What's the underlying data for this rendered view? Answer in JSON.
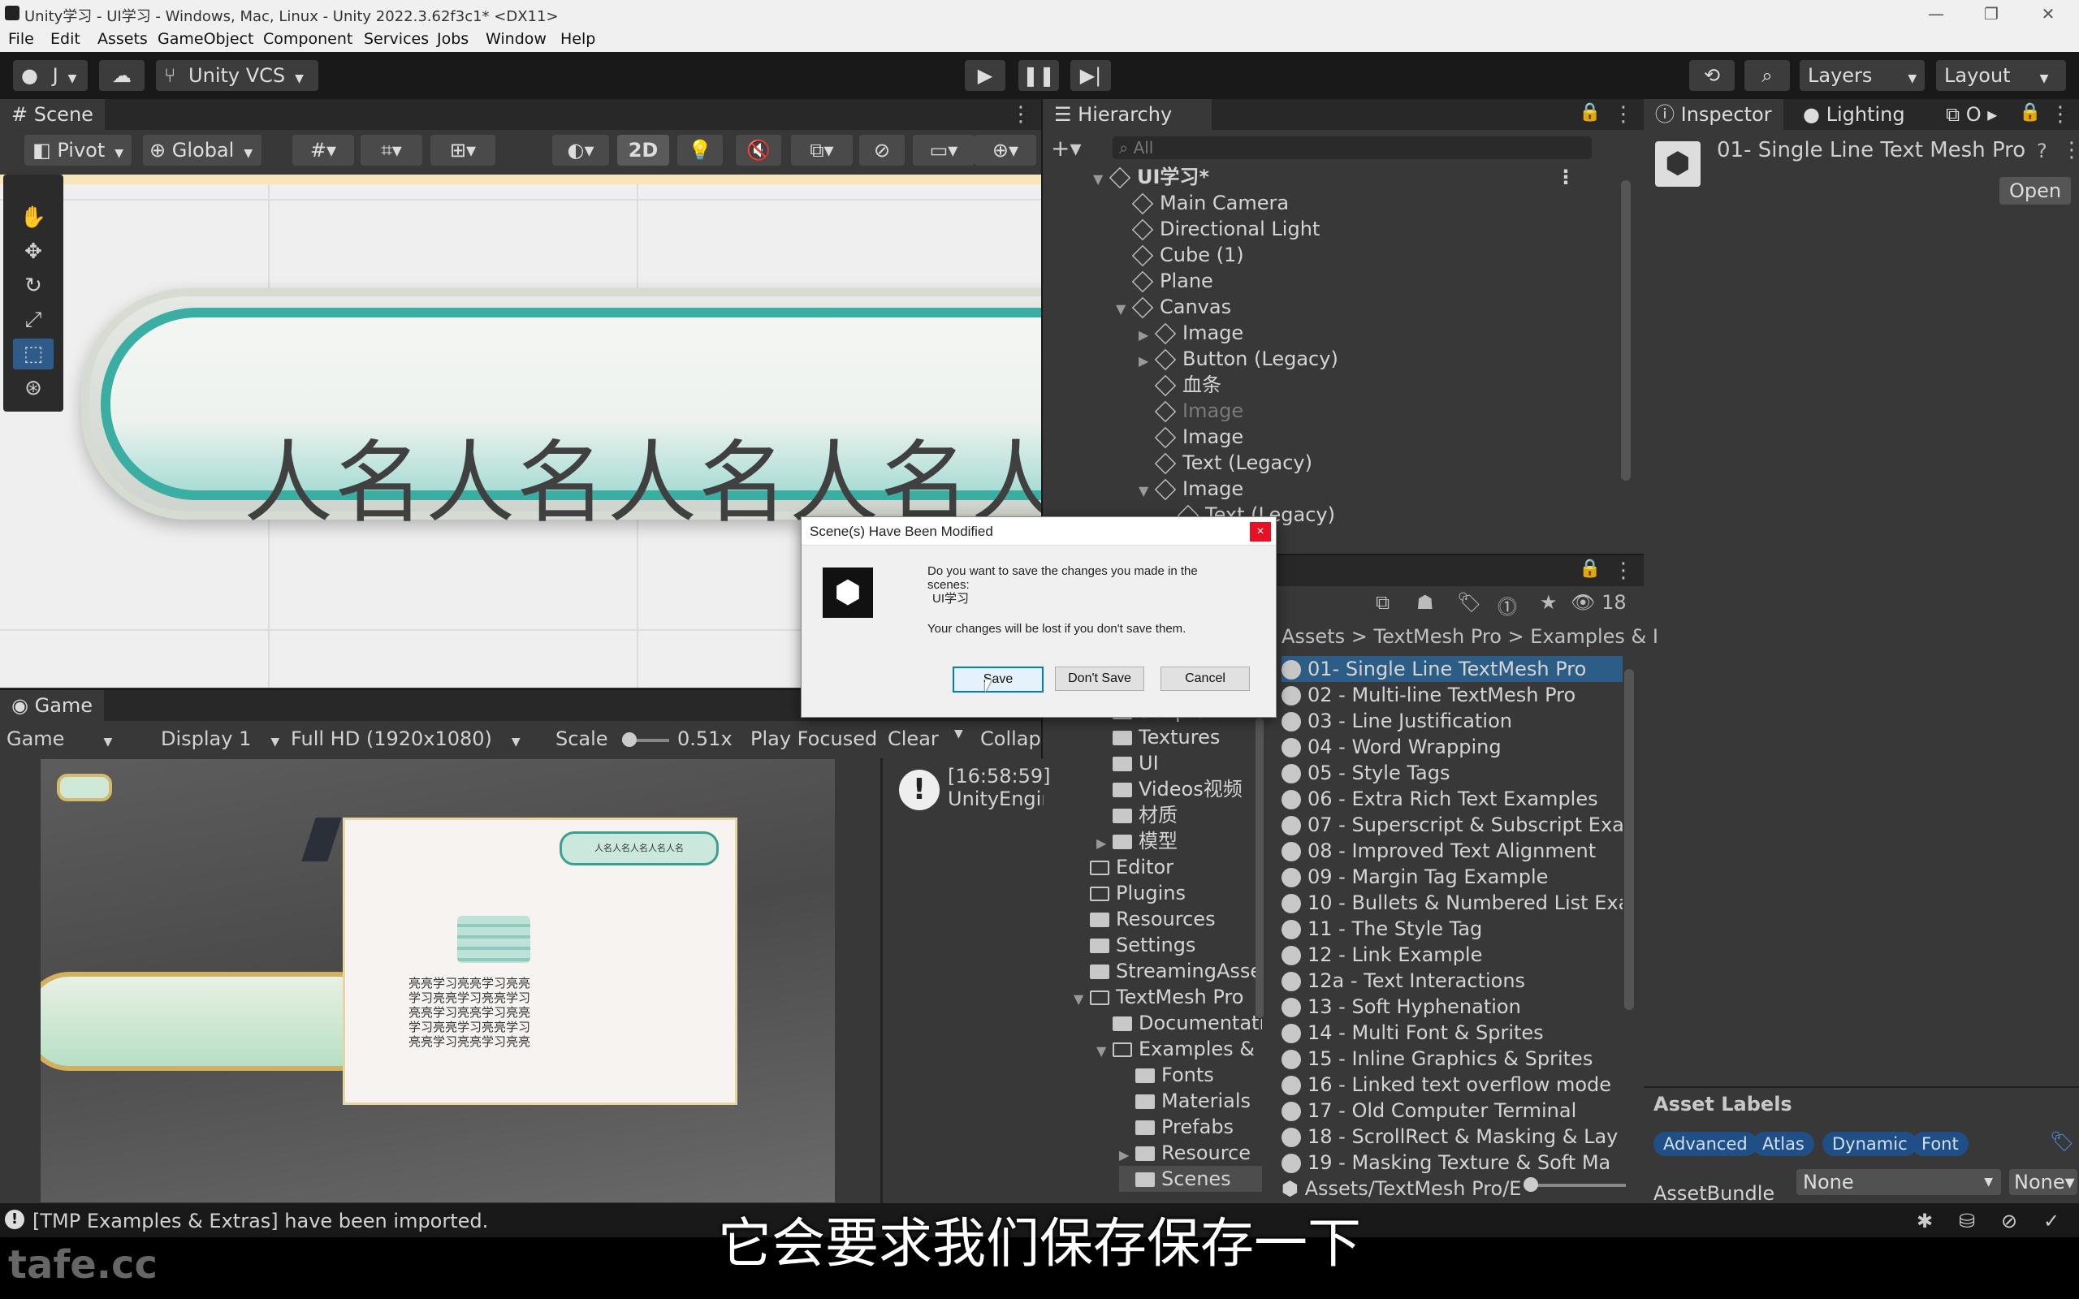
{
  "window": {
    "title": "Unity学习 - UI学习 - Windows, Mac, Linux - Unity 2022.3.62f3c1* <DX11>"
  },
  "menu": [
    "File",
    "Edit",
    "Assets",
    "GameObject",
    "Component",
    "Services",
    "Jobs",
    "Window",
    "Help"
  ],
  "toolbar": {
    "account": "J",
    "vcs": "Unity VCS",
    "layers": "Layers",
    "layout": "Layout"
  },
  "scene": {
    "tab": "Scene",
    "pivot": "Pivot",
    "global": "Global",
    "mode2d": "2D",
    "text": "人名人名人名人名人"
  },
  "hierarchy": {
    "tab": "Hierarchy",
    "search_placeholder": "All",
    "items": [
      {
        "label": "UI学习*",
        "level": 0,
        "expand": "▼",
        "bold": true
      },
      {
        "label": "Main Camera",
        "level": 1,
        "expand": ""
      },
      {
        "label": "Directional Light",
        "level": 1,
        "expand": ""
      },
      {
        "label": "Cube (1)",
        "level": 1,
        "expand": ""
      },
      {
        "label": "Plane",
        "level": 1,
        "expand": ""
      },
      {
        "label": "Canvas",
        "level": 1,
        "expand": "▼"
      },
      {
        "label": "Image",
        "level": 2,
        "expand": "▶"
      },
      {
        "label": "Button (Legacy)",
        "level": 2,
        "expand": "▶"
      },
      {
        "label": "血条",
        "level": 2,
        "expand": ""
      },
      {
        "label": "Image",
        "level": 2,
        "expand": "",
        "dim": true
      },
      {
        "label": "Image",
        "level": 2,
        "expand": ""
      },
      {
        "label": "Text (Legacy)",
        "level": 2,
        "expand": ""
      },
      {
        "label": "Image",
        "level": 2,
        "expand": "▼"
      },
      {
        "label": "Text (Legacy)",
        "level": 3,
        "expand": ""
      }
    ]
  },
  "inspector": {
    "tab": "Inspector",
    "lighting_tab": "Lighting",
    "other_tab": "O",
    "asset_title": "01-  Single Line Text Mesh Pro",
    "open_button": "Open",
    "asset_labels_title": "Asset Labels",
    "labels": [
      "Advanced",
      "Atlas",
      "Dynamic",
      "Font"
    ],
    "assetbundle_label": "AssetBundle",
    "assetbundle_value": "None",
    "variant_value": "None"
  },
  "game": {
    "tab": "Game",
    "mode": "Game",
    "display": "Display 1",
    "resolution": "Full HD (1920x1080)",
    "scale_label": "Scale",
    "scale_value": "0.51x",
    "play_focused": "Play Focused",
    "card_button": "人名人名人名人名人名",
    "card_text": [
      "亮亮学习亮亮学习亮亮",
      "学习亮亮学习亮亮学习",
      "亮亮学习亮亮学习亮亮",
      "学习亮亮学习亮亮学习",
      "亮亮学习亮亮学习亮亮"
    ]
  },
  "console": {
    "clear": "Clear",
    "collapse": "Collap",
    "time": "[16:58:59]",
    "message": "UnityEngin"
  },
  "project": {
    "count": "18",
    "breadcrumb": [
      "Assets",
      "TextMesh Pro",
      "Examples & I"
    ],
    "folders": [
      {
        "label": "Scripts",
        "indent": 2
      },
      {
        "label": "Textures",
        "indent": 2
      },
      {
        "label": "UI",
        "indent": 2
      },
      {
        "label": "Videos视频",
        "indent": 2
      },
      {
        "label": "材质",
        "indent": 2
      },
      {
        "label": "模型",
        "indent": 2,
        "expand": "▶"
      },
      {
        "label": "Editor",
        "indent": 1,
        "open": true
      },
      {
        "label": "Plugins",
        "indent": 1,
        "open": true
      },
      {
        "label": "Resources",
        "indent": 1
      },
      {
        "label": "Settings",
        "indent": 1
      },
      {
        "label": "StreamingAsse",
        "indent": 1
      },
      {
        "label": "TextMesh Pro",
        "indent": 1,
        "expand": "▼",
        "open": true
      },
      {
        "label": "Documentati",
        "indent": 2
      },
      {
        "label": "Examples &",
        "indent": 2,
        "expand": "▼",
        "open": true
      },
      {
        "label": "Fonts",
        "indent": 3
      },
      {
        "label": "Materials",
        "indent": 3
      },
      {
        "label": "Prefabs",
        "indent": 3
      },
      {
        "label": "Resource",
        "indent": 3,
        "expand": "▶"
      },
      {
        "label": "Scenes",
        "indent": 3,
        "selected": true
      }
    ],
    "files": [
      "01-  Single Line TextMesh Pro",
      "02 - Multi-line TextMesh Pro",
      "03 - Line Justification",
      "04 - Word Wrapping",
      "05 - Style Tags",
      "06 - Extra Rich Text Examples",
      "07 - Superscript & Subscript Exa",
      "08 - Improved Text Alignment",
      "09 - Margin Tag Example",
      "10 - Bullets & Numbered List Exa",
      "11 - The Style Tag",
      "12 - Link Example",
      "12a - Text Interactions",
      "13 - Soft Hyphenation",
      "14 - Multi Font & Sprites",
      "15 - Inline Graphics & Sprites",
      "16 - Linked text overflow mode",
      "17 - Old Computer Terminal",
      "18 - ScrollRect & Masking & Lay",
      "19 - Masking Texture & Soft Ma"
    ],
    "path": "Assets/TextMesh Pro/E"
  },
  "dialog": {
    "title": "Scene(s) Have Been Modified",
    "line1": "Do you want to save the changes you made in the",
    "line2": "scenes:",
    "line3": "UI学习",
    "line4": "Your changes will be lost if you don't save them.",
    "save": "Save",
    "dont_save": "Don't Save",
    "cancel": "Cancel"
  },
  "statusbar": {
    "message": "[TMP Examples & Extras] have been imported."
  },
  "watermark": "tafe.cc",
  "subtitle": "它会要求我们保存保存一下"
}
